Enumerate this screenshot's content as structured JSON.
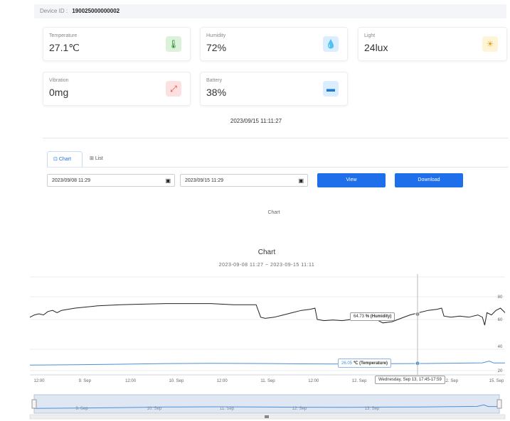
{
  "device": {
    "label": "Device ID :",
    "id": "190025000000002"
  },
  "cards": [
    {
      "label": "Temperature",
      "value": "27.1℃",
      "icon": "thermometer-icon"
    },
    {
      "label": "Humidity",
      "value": "72%",
      "icon": "droplet-icon"
    },
    {
      "label": "Light",
      "value": "24lux",
      "icon": "sun-icon"
    },
    {
      "label": "Vibration",
      "value": "0mg",
      "icon": "vibration-icon"
    },
    {
      "label": "Battery",
      "value": "38%",
      "icon": "battery-icon"
    }
  ],
  "timestamp": "2023/09/15 11:11:27",
  "tabs": [
    {
      "label": "Chart",
      "icon": "chart-icon"
    },
    {
      "label": "List",
      "icon": "grid-icon"
    }
  ],
  "filters": {
    "start": "2023/09/08 11:29",
    "end": "2023/09/15 11:29",
    "view_label": "View",
    "download_label": "Download"
  },
  "chart_small_title": "Chart",
  "chart_data": {
    "type": "line",
    "title": "Chart",
    "subtitle": "2023-09-08 11:27 ~ 2023-09-15 11:11",
    "x_tick_labels": [
      "12:00",
      "9. Sep",
      "12:00",
      "10. Sep",
      "12:00",
      "11. Sep",
      "12:00",
      "12. Sep",
      "12:00",
      "12. Sep",
      "15. Sep"
    ],
    "navigator_labels": [
      "9. Sep",
      "10. Sep",
      "11. Sep",
      "12. Sep",
      "13. Sep"
    ],
    "y_ticks_humidity": [
      80,
      60
    ],
    "y_ticks_temperature": [
      40,
      20
    ],
    "series": [
      {
        "name": "Humidity",
        "unit": "%",
        "color": "#222222",
        "points": [
          [
            0,
            62
          ],
          [
            2,
            64
          ],
          [
            4,
            65
          ],
          [
            6,
            64
          ],
          [
            8,
            67
          ],
          [
            10,
            68
          ],
          [
            12,
            66
          ],
          [
            14,
            68
          ],
          [
            20,
            70
          ],
          [
            30,
            72
          ],
          [
            40,
            73
          ],
          [
            50,
            73.5
          ],
          [
            60,
            74
          ],
          [
            70,
            74
          ],
          [
            80,
            74
          ],
          [
            90,
            73
          ],
          [
            100,
            73
          ],
          [
            102,
            62
          ],
          [
            104,
            61
          ],
          [
            108,
            62
          ],
          [
            112,
            64
          ],
          [
            116,
            66
          ],
          [
            120,
            68
          ],
          [
            124,
            69
          ],
          [
            126,
            70
          ],
          [
            127,
            60
          ],
          [
            130,
            59
          ],
          [
            134,
            59.5
          ],
          [
            138,
            59
          ],
          [
            142,
            60
          ],
          [
            148,
            61
          ],
          [
            152,
            62
          ],
          [
            154,
            59
          ],
          [
            156,
            57
          ],
          [
            160,
            58
          ],
          [
            164,
            61
          ],
          [
            168,
            64
          ],
          [
            172,
            66
          ],
          [
            176,
            68
          ],
          [
            180,
            69
          ],
          [
            182,
            70
          ],
          [
            183,
            63
          ],
          [
            186,
            62
          ],
          [
            190,
            63
          ],
          [
            194,
            62
          ],
          [
            198,
            64
          ],
          [
            200,
            62
          ],
          [
            201,
            55
          ],
          [
            202,
            66
          ],
          [
            204,
            64
          ],
          [
            206,
            68
          ],
          [
            208,
            70
          ],
          [
            210,
            66
          ]
        ]
      },
      {
        "name": "Temperature",
        "unit": "℃",
        "color": "#4a90d9",
        "points": [
          [
            0,
            24.5
          ],
          [
            20,
            24.8
          ],
          [
            40,
            25.3
          ],
          [
            60,
            25.8
          ],
          [
            80,
            26.0
          ],
          [
            100,
            25.9
          ],
          [
            120,
            25.6
          ],
          [
            140,
            25.5
          ],
          [
            160,
            25.7
          ],
          [
            175,
            25.9
          ],
          [
            182,
            26.0
          ],
          [
            190,
            26.2
          ],
          [
            200,
            26.4
          ],
          [
            203,
            27.8
          ],
          [
            205,
            26.3
          ],
          [
            210,
            26.3
          ]
        ]
      }
    ],
    "tooltips": {
      "humidity": {
        "value": "64.73",
        "label": "% (Humidity)"
      },
      "temperature": {
        "value": "26.05",
        "label": "℃ (Temperature)"
      },
      "time": "Wednesday, Sep 13, 17:45-17:59"
    }
  }
}
